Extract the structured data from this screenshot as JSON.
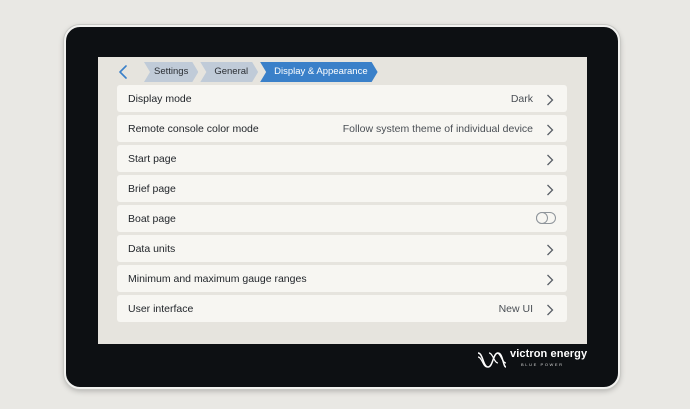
{
  "breadcrumb": [
    "Settings",
    "General",
    "Display & Appearance"
  ],
  "rows": [
    {
      "label": "Display mode",
      "value": "Dark"
    },
    {
      "label": "Remote console color mode",
      "value": "Follow system theme of individual device"
    },
    {
      "label": "Start page",
      "value": ""
    },
    {
      "label": "Brief page",
      "value": ""
    },
    {
      "label": "Boat page",
      "value": "",
      "toggle": false
    },
    {
      "label": "Data units",
      "value": ""
    },
    {
      "label": "Minimum and maximum gauge ranges",
      "value": ""
    },
    {
      "label": "User interface",
      "value": "New UI"
    }
  ],
  "brand": {
    "name": "victron energy",
    "tagline": "BLUE POWER"
  },
  "colors": {
    "accent": "#3a80c9",
    "crumb": "#c0cbd8",
    "row_bg": "#f7f6f2",
    "screen_bg": "#e6e4de",
    "bezel": "#0d1013"
  },
  "icons": {
    "back": "chevron-left-icon",
    "row_nav": "chevron-right-icon",
    "logo": "victron-logo-icon"
  }
}
